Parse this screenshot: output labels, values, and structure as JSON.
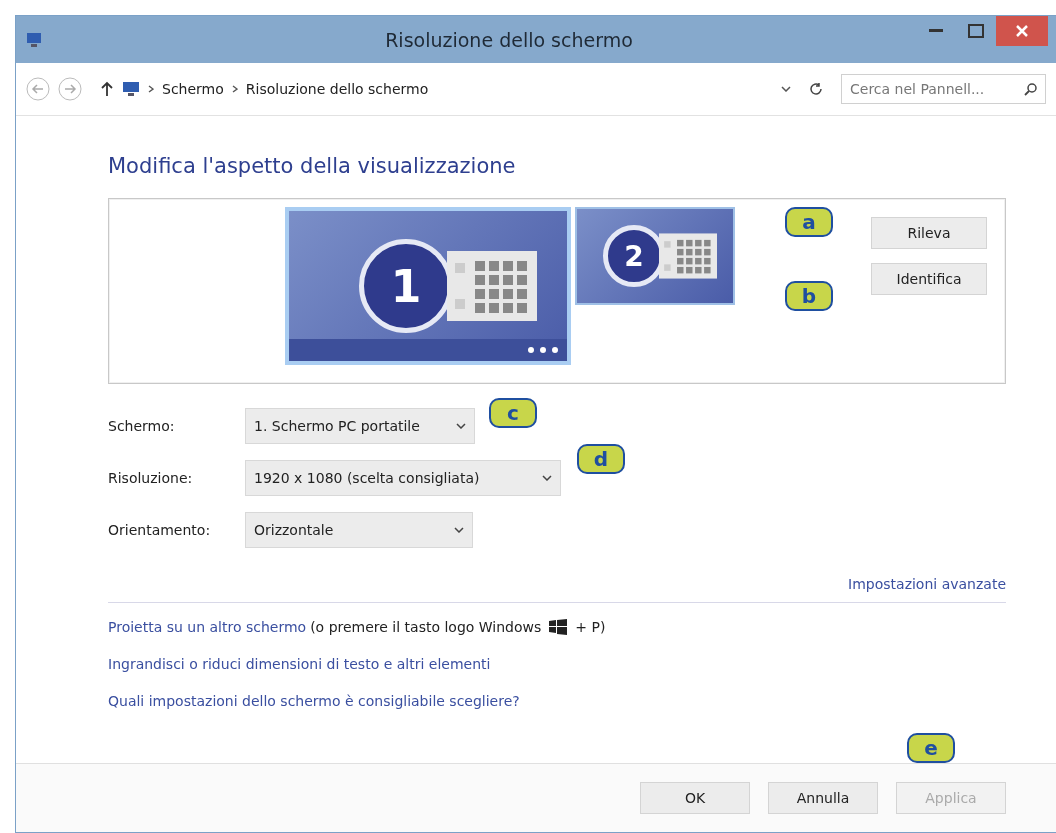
{
  "window": {
    "title": "Risoluzione dello schermo"
  },
  "address_bar": {
    "breadcrumbs": [
      "Schermo",
      "Risoluzione dello schermo"
    ],
    "search": {
      "placeholder": "Cerca nel Pannell..."
    }
  },
  "heading": "Modifica l'aspetto della visualizzazione",
  "monitors": [
    {
      "label": "1",
      "selected": true
    },
    {
      "label": "2",
      "selected": false
    }
  ],
  "monitor_buttons": [
    "Rileva",
    "Identifica"
  ],
  "fields": [
    {
      "label": "Schermo:",
      "value": "1. Schermo PC portatile"
    },
    {
      "label": "Risoluzione:",
      "value": "1920 x 1080 (scelta consigliata)"
    },
    {
      "label": "Orientamento:",
      "value": "Orizzontale"
    }
  ],
  "advanced_link": "Impostazioni avanzate",
  "project": {
    "link": "Proietta su un altro schermo",
    "note_before": "(o premere il tasto logo Windows",
    "note_after": "+ P)"
  },
  "links": [
    "Ingrandisci o riduci dimensioni di testo e altri elementi",
    "Quali impostazioni dello schermo è consigliabile scegliere?"
  ],
  "buttons": [
    {
      "label": "OK",
      "disabled": false
    },
    {
      "label": "Annulla",
      "disabled": false
    },
    {
      "label": "Applica",
      "disabled": true
    }
  ],
  "callouts": [
    "a",
    "b",
    "c",
    "d",
    "e"
  ]
}
